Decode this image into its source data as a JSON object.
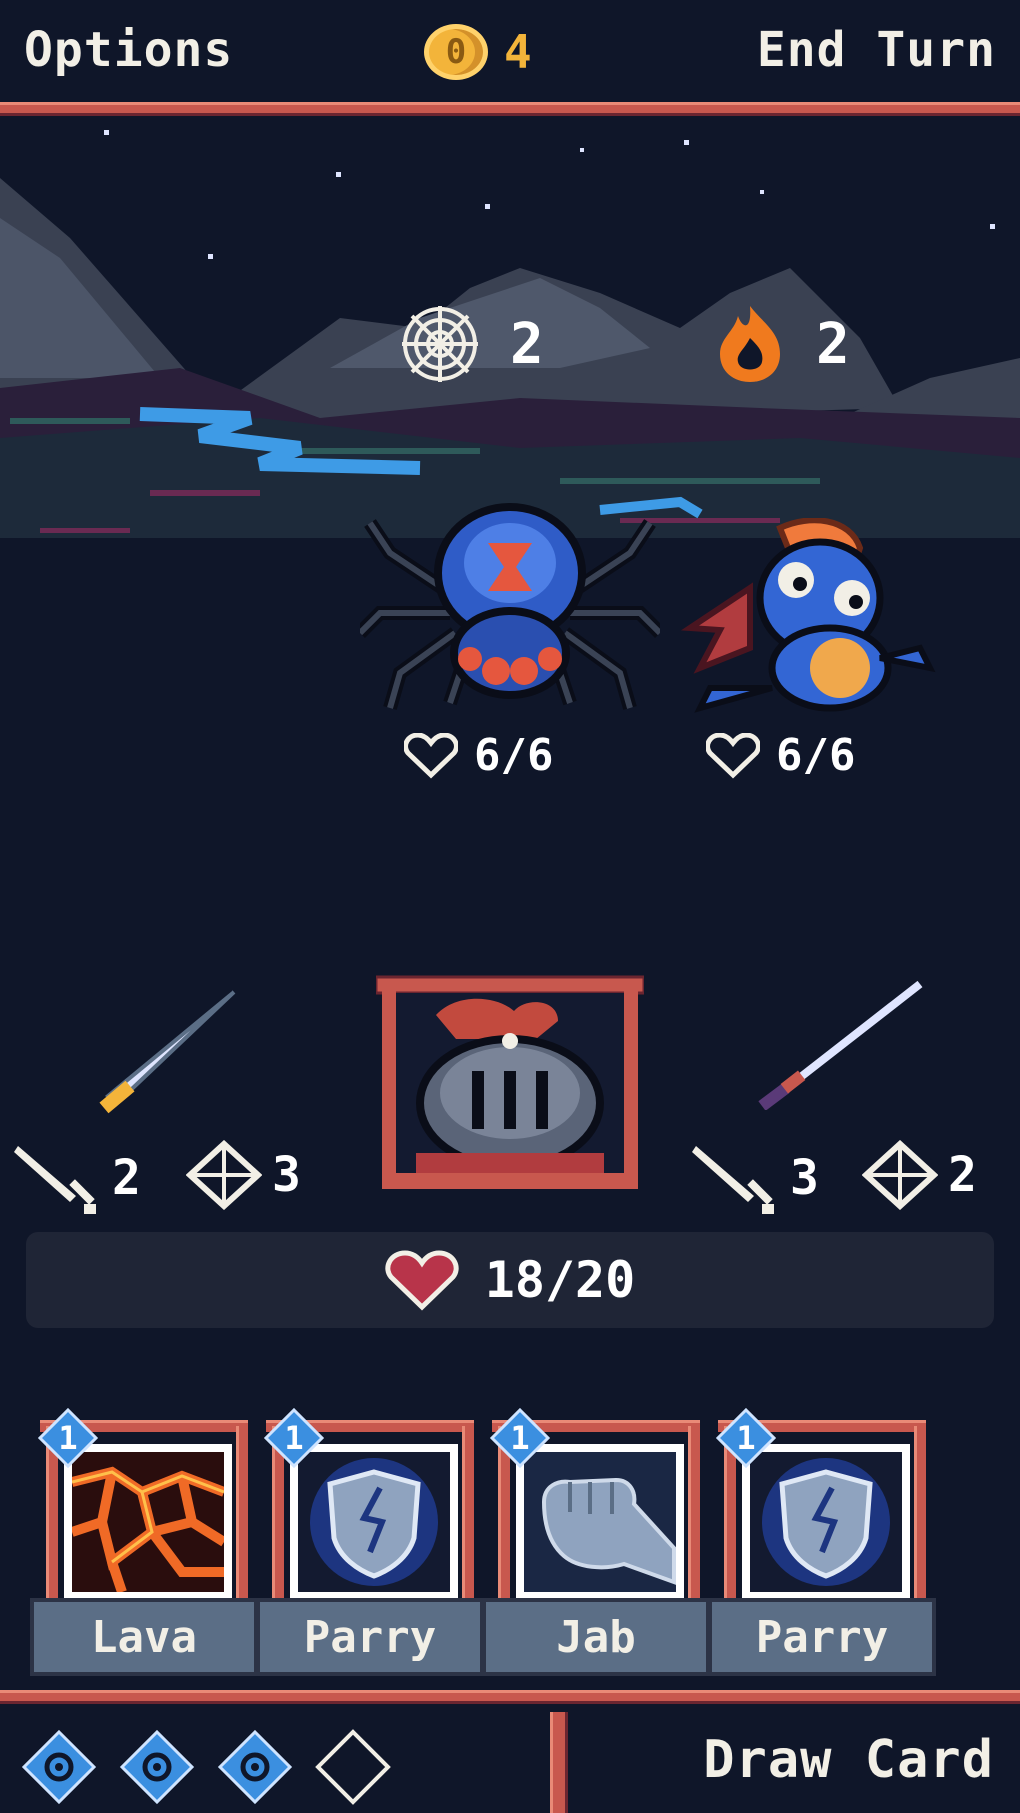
{
  "top_bar": {
    "options_label": "Options",
    "coins": "4",
    "coin_symbol": "0",
    "end_turn_label": "End Turn"
  },
  "enemies": {
    "status_web": "2",
    "status_burn": "2",
    "spider_hp": "6/6",
    "dragon_hp": "6/6"
  },
  "hero": {
    "left_attack": "2",
    "left_defense": "3",
    "right_attack": "3",
    "right_defense": "2",
    "hp": "18/20"
  },
  "hand": [
    {
      "name": "Lava",
      "cost": "1",
      "art": "lava-icon"
    },
    {
      "name": "Parry",
      "cost": "1",
      "art": "shield-icon"
    },
    {
      "name": "Jab",
      "cost": "1",
      "art": "fist-icon"
    },
    {
      "name": "Parry",
      "cost": "1",
      "art": "shield-icon"
    }
  ],
  "bottom_bar": {
    "energy_filled": 3,
    "energy_total": 4,
    "draw_card_label": "Draw Card"
  },
  "colors": {
    "background": "#0f1629",
    "accent_rail": "#c8584e",
    "coin": "#f3b43a",
    "energy": "#3b8fe0",
    "card_label": "#5b6e86"
  }
}
